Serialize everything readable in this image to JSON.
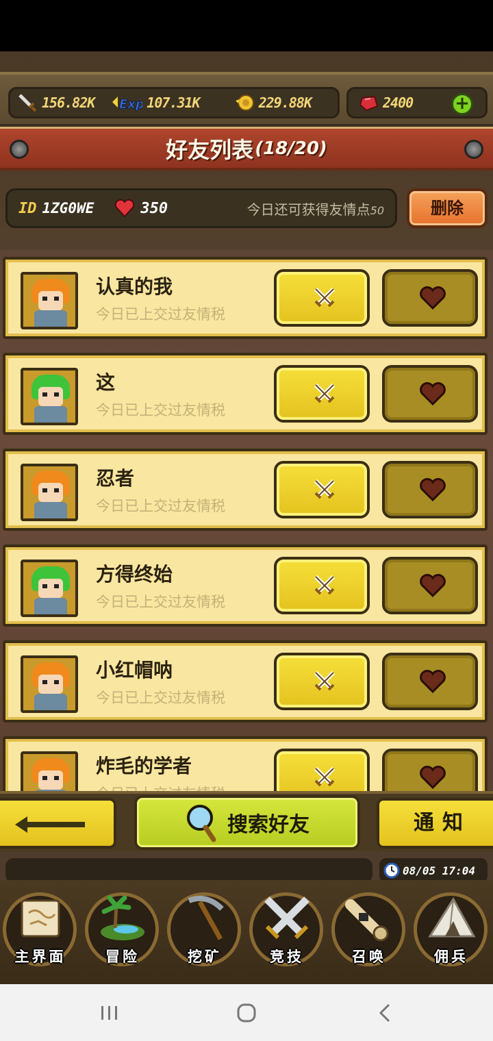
{
  "resources": {
    "attack": "156.82K",
    "exp_label": "Exp",
    "exp": "107.31K",
    "gold": "229.88K",
    "gems": "2400"
  },
  "header": {
    "title": "好友列表",
    "count": "(18/20)"
  },
  "profile": {
    "id_label": "ID",
    "id_value": "1ZG0WE",
    "hearts": "350",
    "friendship_text": "今日还可获得友情点",
    "friendship_points": "50",
    "delete_label": "删除"
  },
  "friends": [
    {
      "name": "认真的我",
      "status": "今日已上交过友情税",
      "avatar": "orange-hair-hero"
    },
    {
      "name": "这",
      "status": "今日已上交过友情税",
      "avatar": "green-hair-hero"
    },
    {
      "name": "忍者",
      "status": "今日已上交过友情税",
      "avatar": "orange-hair-hero"
    },
    {
      "name": "方得终始",
      "status": "今日已上交过友情税",
      "avatar": "green-hair-hero"
    },
    {
      "name": "小红帽呐",
      "status": "今日已上交过友情税",
      "avatar": "orange-hair-hero"
    },
    {
      "name": "炸毛的学者",
      "status": "今日已上交过友情税",
      "avatar": "orange-hair-hero"
    }
  ],
  "actions": {
    "search_label": "搜索好友",
    "notify_label": "通知"
  },
  "status": {
    "datetime": "08/05 17:04"
  },
  "nav": [
    {
      "label": "主界面",
      "icon": "scroll-map-icon"
    },
    {
      "label": "冒险",
      "icon": "island-icon"
    },
    {
      "label": "挖矿",
      "icon": "pickaxe-icon"
    },
    {
      "label": "竞技",
      "icon": "crossed-swords-icon"
    },
    {
      "label": "召唤",
      "icon": "summon-scroll-icon"
    },
    {
      "label": "佣兵",
      "icon": "tent-icon"
    }
  ],
  "colors": {
    "banner": "#a33e26",
    "row_bg": "#f9e6a0",
    "yellow_button": "#f0d42e",
    "search_button": "#c9dc2e",
    "delete_button": "#ee8a40",
    "gold_text": "#f3d777"
  }
}
